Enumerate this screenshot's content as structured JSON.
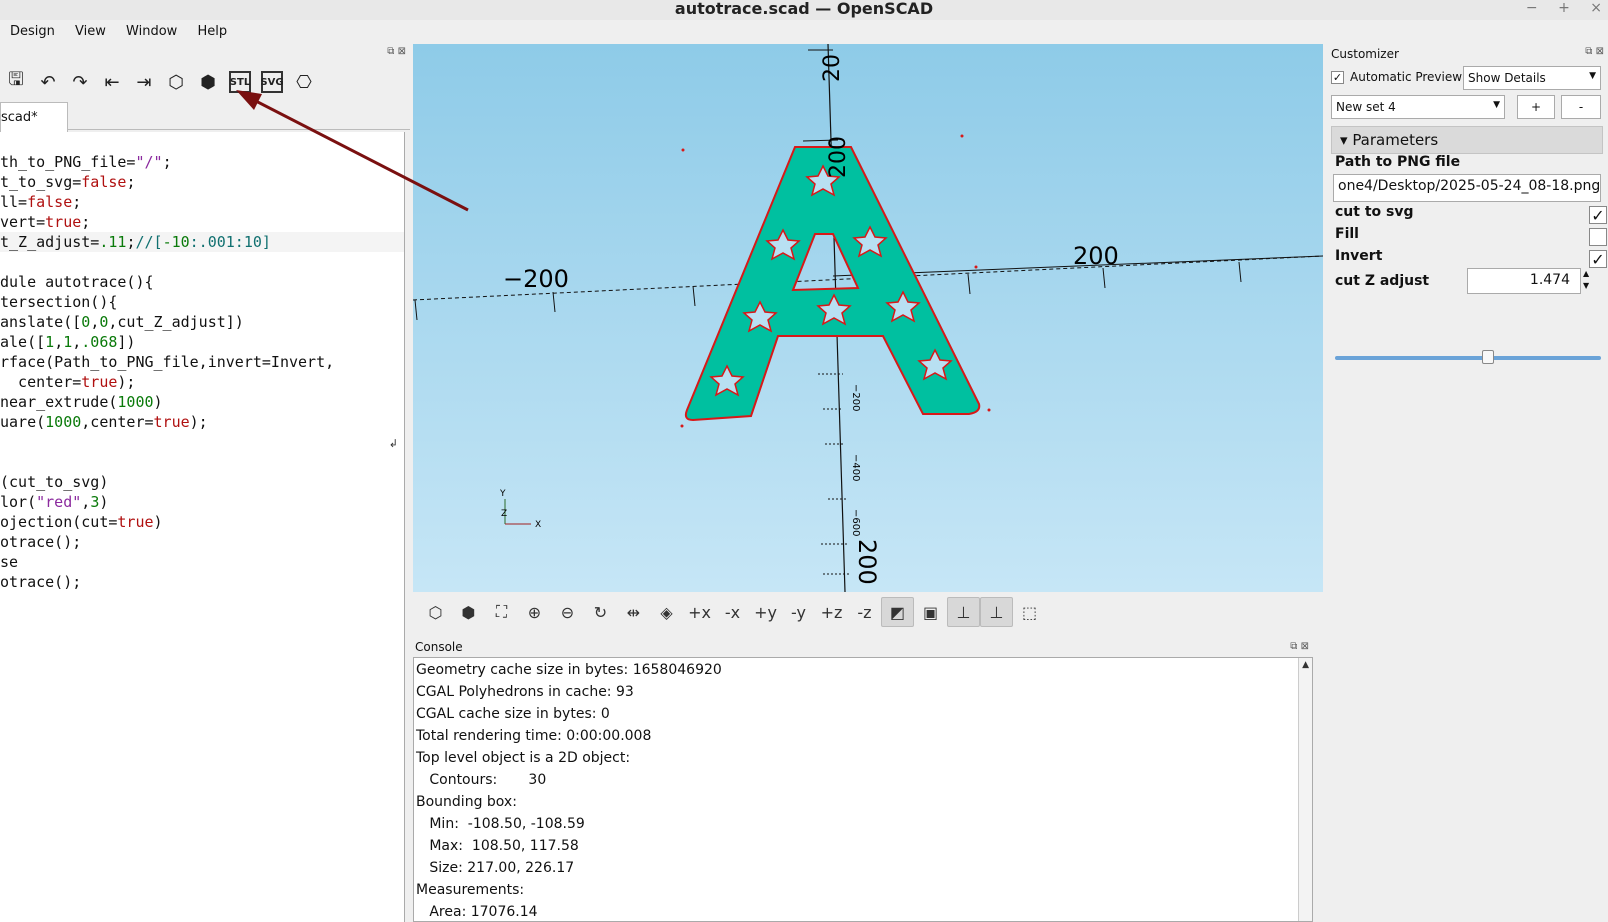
{
  "window": {
    "title": "autotrace.scad — OpenSCAD",
    "controls": [
      "−",
      "+",
      "×"
    ]
  },
  "menu": [
    "Design",
    "View",
    "Window",
    "Help"
  ],
  "editor": {
    "tab_label": "scad*",
    "lines": [
      "",
      "th_to_PNG_file=\"/\";",
      "t_to_svg=false;",
      "ll=false;",
      "vert=true;",
      "t_Z_adjust=.11;//[-10:.001:10]",
      "",
      "dule autotrace(){",
      "tersection(){",
      "anslate([0,0,cut_Z_adjust])",
      "ale([1,1,.068])",
      "rface(Path_to_PNG_file,invert=Invert,",
      "  center=true);",
      "near_extrude(1000)",
      "uare(1000,center=true);",
      "",
      "",
      "(cut_to_svg)",
      "lor(\"red\",3)",
      "ojection(cut=true)",
      "otrace();",
      "se",
      "otrace();"
    ]
  },
  "viewport": {
    "axis_labels": {
      "x_neg": "−200",
      "x_pos": "200",
      "y_top": "200",
      "z_top": "20",
      "z_neg": "−200",
      "tick_mid": "−400",
      "tick_low": "−600",
      "y_bottom": "200"
    },
    "model_color": "#00c0a0",
    "outline_color": "#d81818",
    "bg_color": "#9fd4ee"
  },
  "console": {
    "title": "Console",
    "lines": [
      "Geometry cache size in bytes: 1658046920",
      "CGAL Polyhedrons in cache: 93",
      "CGAL cache size in bytes: 0",
      "Total rendering time: 0:00:00.008",
      "Top level object is a 2D object:",
      "   Contours:       30",
      "Bounding box:",
      "   Min:  -108.50, -108.59",
      "   Max:  108.50, 117.58",
      "   Size: 217.00, 226.17",
      "Measurements:",
      "   Area: 17076.14"
    ]
  },
  "customizer": {
    "title": "Customizer",
    "auto_preview_label": "Automatic Preview",
    "auto_preview_checked": true,
    "details_select": "Show Details",
    "preset_select": "New set 4",
    "add_label": "+",
    "remove_label": "-",
    "params_header": "Parameters",
    "path_label": "Path to PNG file",
    "path_value": "one4/Desktop/2025-05-24_08-18.png",
    "cut_to_svg_label": "cut to svg",
    "cut_to_svg_checked": true,
    "fill_label": "Fill",
    "fill_checked": false,
    "invert_label": "Invert",
    "invert_checked": true,
    "cut_z_label": "cut Z adjust",
    "cut_z_value": "1.474",
    "slider_fraction": 0.574
  },
  "annotation": {
    "arrow_color": "#7a1010"
  }
}
